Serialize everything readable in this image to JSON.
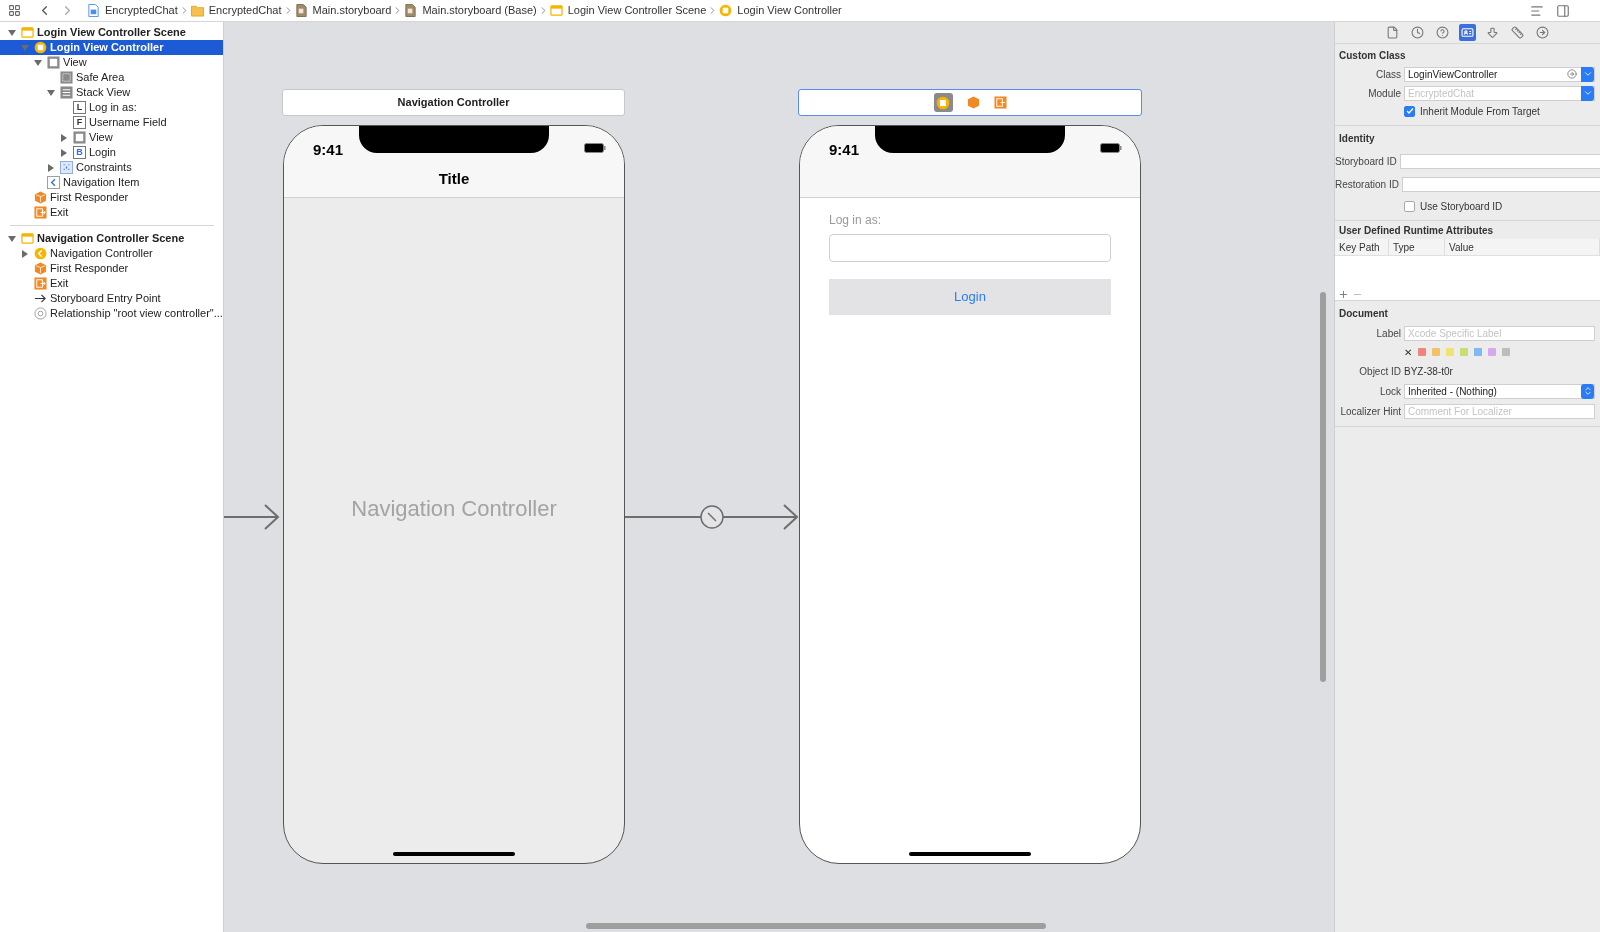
{
  "toolbar": {
    "breadcrumbs": [
      {
        "label": "EncryptedChat",
        "kind": "project"
      },
      {
        "label": "EncryptedChat",
        "kind": "folder"
      },
      {
        "label": "Main.storyboard",
        "kind": "storyboard"
      },
      {
        "label": "Main.storyboard (Base)",
        "kind": "storyboard"
      },
      {
        "label": "Login View Controller Scene",
        "kind": "scene"
      },
      {
        "label": "Login View Controller",
        "kind": "controller"
      }
    ]
  },
  "outline": [
    {
      "label": "Login View Controller Scene",
      "kind": "scene",
      "expanded": true,
      "selected": false,
      "children": [
        {
          "label": "Login View Controller",
          "kind": "controller",
          "expanded": true,
          "selected": true,
          "children": [
            {
              "label": "View",
              "kind": "view",
              "expanded": true,
              "selected": false,
              "children": [
                {
                  "label": "Safe Area",
                  "kind": "safe-area",
                  "selected": false
                },
                {
                  "label": "Stack View",
                  "kind": "stack",
                  "expanded": true,
                  "selected": false,
                  "children": [
                    {
                      "label": "Log in as:",
                      "kind": "label",
                      "glyph": "L",
                      "selected": false
                    },
                    {
                      "label": "Username Field",
                      "kind": "field",
                      "glyph": "F",
                      "selected": false
                    },
                    {
                      "label": "View",
                      "kind": "view",
                      "expanded": false,
                      "selected": false
                    },
                    {
                      "label": "Login",
                      "kind": "button",
                      "glyph": "B",
                      "expanded": false,
                      "selected": false
                    }
                  ]
                },
                {
                  "label": "Constraints",
                  "kind": "constraints",
                  "expanded": false,
                  "selected": false
                }
              ]
            },
            {
              "label": "Navigation Item",
              "kind": "nav-item",
              "selected": false
            }
          ]
        },
        {
          "label": "First Responder",
          "kind": "responder",
          "selected": false
        },
        {
          "label": "Exit",
          "kind": "exit",
          "selected": false
        }
      ]
    },
    {
      "label": "Navigation Controller Scene",
      "kind": "scene",
      "expanded": true,
      "selected": false,
      "children": [
        {
          "label": "Navigation Controller",
          "kind": "nav-controller",
          "expanded": false,
          "selected": false
        },
        {
          "label": "First Responder",
          "kind": "responder",
          "selected": false
        },
        {
          "label": "Exit",
          "kind": "exit",
          "selected": false
        },
        {
          "label": "Storyboard Entry Point",
          "kind": "entry",
          "selected": false
        },
        {
          "label": "Relationship \"root view controller\"...",
          "kind": "relationship",
          "selected": false
        }
      ]
    }
  ],
  "canvas": {
    "navigation_scene": {
      "title": "Navigation Controller",
      "time": "9:41",
      "nav_title": "Title",
      "placeholder": "Navigation Controller"
    },
    "login_scene": {
      "selected": true,
      "time": "9:41",
      "field_label": "Log in as:",
      "button": "Login"
    }
  },
  "inspector": {
    "tabs": [
      {
        "kind": "file",
        "selected": false
      },
      {
        "kind": "history",
        "selected": false
      },
      {
        "kind": "help",
        "selected": false
      },
      {
        "kind": "identity",
        "selected": true
      },
      {
        "kind": "attributes",
        "selected": false
      },
      {
        "kind": "size",
        "selected": false
      },
      {
        "kind": "connections",
        "selected": false
      }
    ],
    "custom_class": {
      "title": "Custom Class",
      "class_label": "Class",
      "class_value": "LoginViewController",
      "module_label": "Module",
      "module_placeholder": "EncryptedChat",
      "inherit_label": "Inherit Module From Target",
      "inherit_checked": true
    },
    "identity": {
      "title": "Identity",
      "storyboard_id_label": "Storyboard ID",
      "restoration_id_label": "Restoration ID",
      "use_storyboard_label": "Use Storyboard ID",
      "use_storyboard_checked": false
    },
    "runtime_attributes": {
      "title": "User Defined Runtime Attributes",
      "columns": [
        "Key Path",
        "Type",
        "Value"
      ]
    },
    "document": {
      "title": "Document",
      "label_label": "Label",
      "label_placeholder": "Xcode Specific Label",
      "clear": "✕",
      "swatches": [
        {
          "color": "#f0837c"
        },
        {
          "color": "#f5bf6b"
        },
        {
          "color": "#f2e36e"
        },
        {
          "color": "#c5df6c"
        },
        {
          "color": "#7fb8f5"
        },
        {
          "color": "#d6a9ea"
        },
        {
          "color": "#bdbdbd"
        }
      ],
      "object_id_label": "Object ID",
      "object_id": "BYZ-38-t0r",
      "lock_label": "Lock",
      "lock_value": "Inherited - (Nothing)",
      "hint_label": "Localizer Hint",
      "hint_placeholder": "Comment For Localizer"
    }
  }
}
